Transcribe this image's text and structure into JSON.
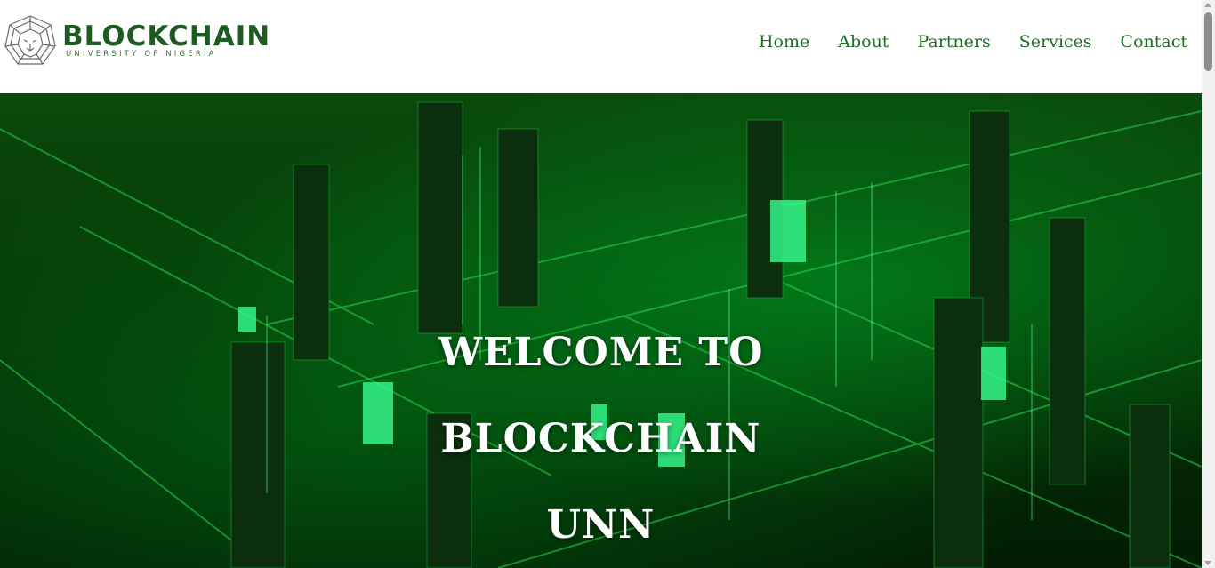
{
  "header": {
    "brand": "BLOCKCHAIN",
    "tagline": "UNIVERSITY OF NIGERIA",
    "logo_icon": "lion-head-icon"
  },
  "nav": {
    "items": [
      {
        "label": "Home"
      },
      {
        "label": "About"
      },
      {
        "label": "Partners"
      },
      {
        "label": "Services"
      },
      {
        "label": "Contact"
      }
    ]
  },
  "hero": {
    "title_lines": [
      "WELCOME TO",
      "BLOCKCHAIN",
      "UNN"
    ],
    "background": "green-blockchain-city-image"
  },
  "colors": {
    "brand_green": "#1e5b22",
    "nav_green": "#1f6e25",
    "hero_dark": "#021d03",
    "hero_glow": "#2bff7a"
  }
}
